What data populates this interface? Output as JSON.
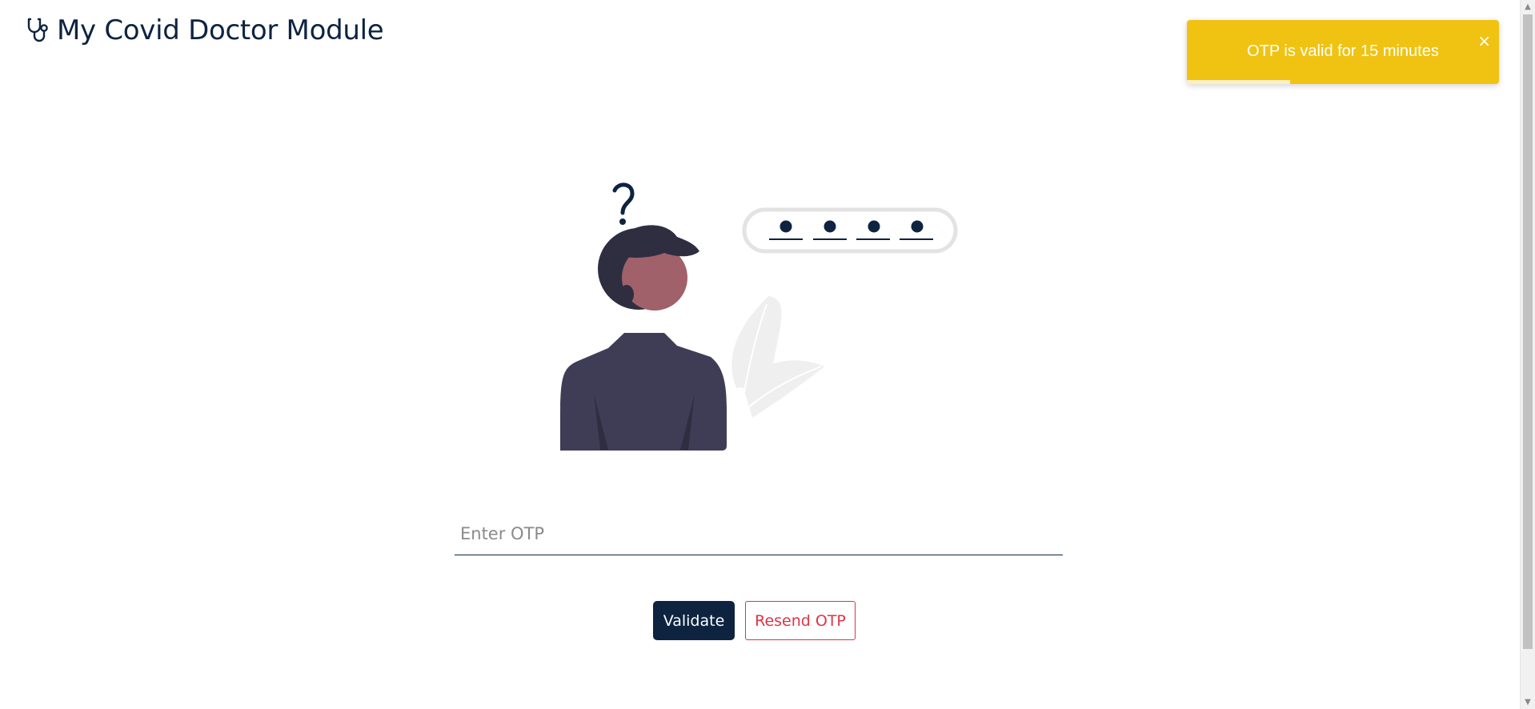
{
  "header": {
    "icon": "stethoscope-icon",
    "title": "My Covid Doctor Module"
  },
  "toast": {
    "message": "OTP is valid for 15 minutes",
    "close_label": "×",
    "progress_fraction": 0.33,
    "color": "#f0c313"
  },
  "otp": {
    "placeholder": "Enter OTP",
    "value": ""
  },
  "actions": {
    "validate_label": "Validate",
    "resend_label": "Resend OTP"
  },
  "colors": {
    "brand": "#0d2340",
    "danger": "#dc3545",
    "toast": "#f0c313"
  }
}
